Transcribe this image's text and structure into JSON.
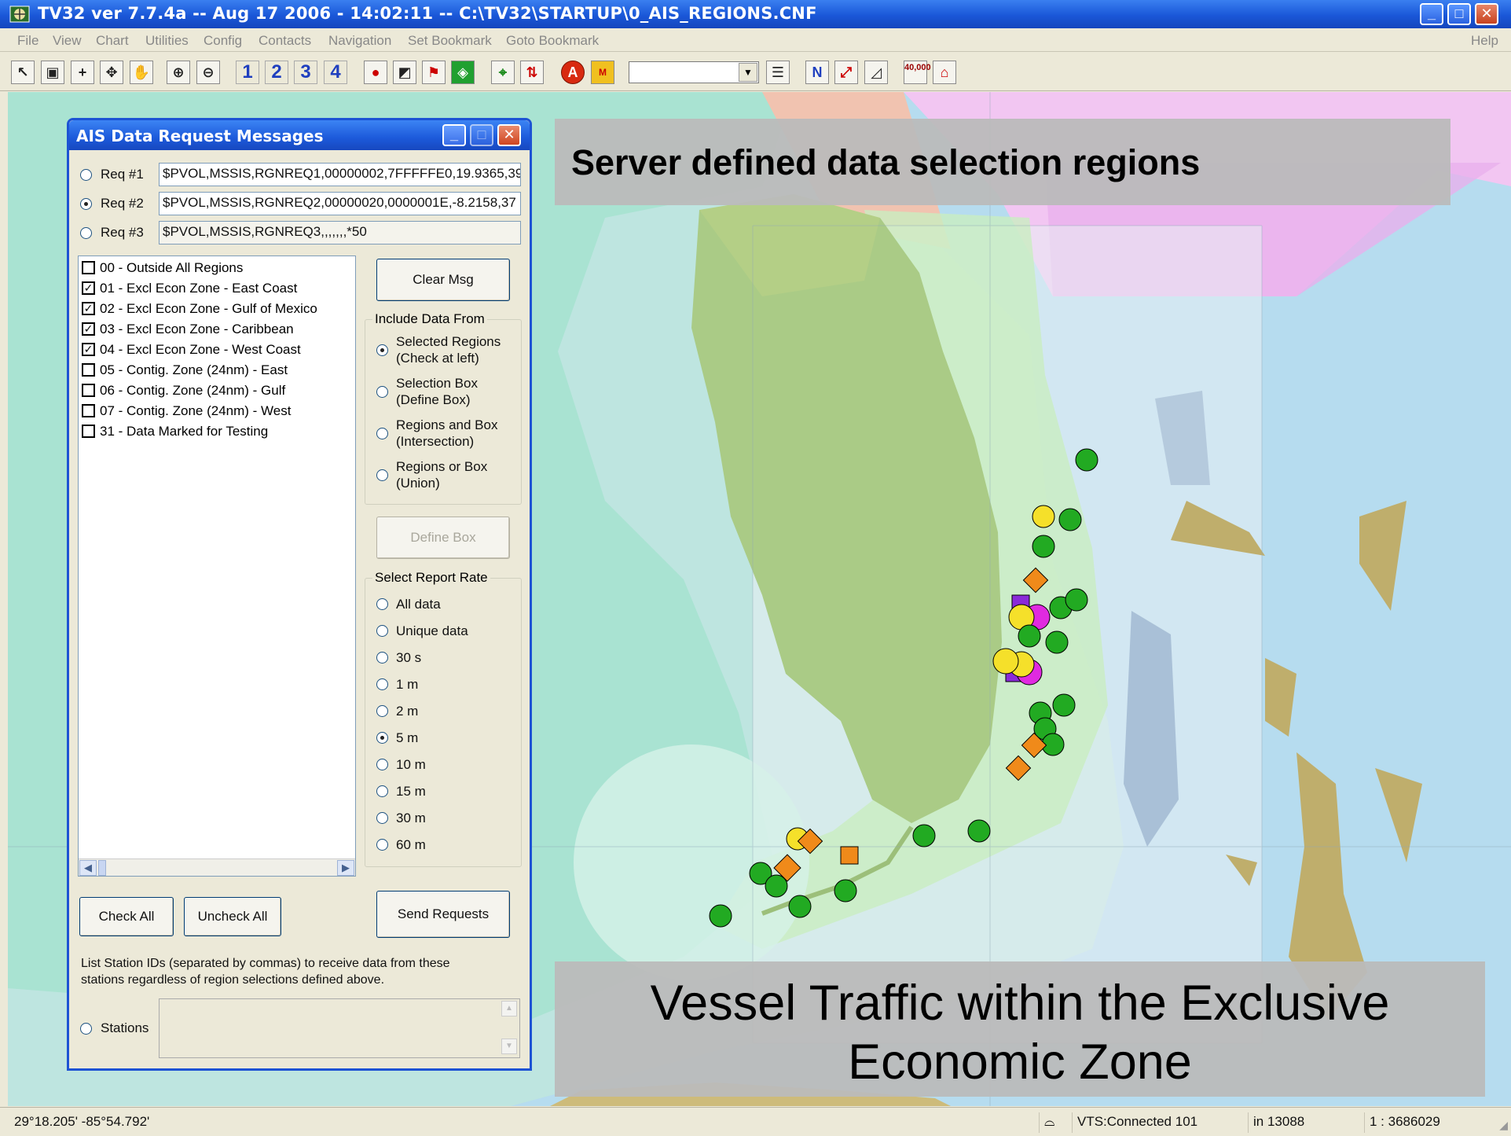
{
  "window": {
    "title": "TV32 ver 7.7.4a -- Aug 17 2006 - 14:02:11 -- C:\\TV32\\STARTUP\\0_AIS_REGIONS.CNF",
    "buttons": [
      "minimize",
      "maximize",
      "close"
    ]
  },
  "menu": {
    "items": [
      "File",
      "View",
      "Chart",
      "Utilities",
      "Config",
      "Contacts",
      "Navigation",
      "Set Bookmark",
      "Goto Bookmark"
    ],
    "help": "Help"
  },
  "toolbar": {
    "mode_buttons": [
      "1",
      "2",
      "3",
      "4"
    ],
    "icons": [
      "pointer-icon",
      "zoom-box-icon",
      "crosshair-icon",
      "pan-icon",
      "hand-icon",
      "zoom-in-icon",
      "zoom-out-icon",
      "marker-icon",
      "chart-icon",
      "flag-icon",
      "world-icon",
      "grid-icon",
      "target-icon",
      "alarm-icon",
      "mob-icon",
      "list-icon",
      "north-up-icon",
      "course-icon",
      "track-icon",
      "scale-icon",
      "home-icon"
    ],
    "scale_button": "40,000",
    "combo_value": ""
  },
  "callouts": {
    "top": "Server defined data selection regions",
    "bottom": "Vessel Traffic within the Exclusive Economic Zone"
  },
  "dialog": {
    "title": "AIS Data Request Messages",
    "requests": [
      {
        "label": "Req #1",
        "value": "$PVOL,MSSIS,RGNREQ1,00000002,7FFFFFE0,19.9365,39",
        "selected": false
      },
      {
        "label": "Req #2",
        "value": "$PVOL,MSSIS,RGNREQ2,00000020,0000001E,-8.2158,37",
        "selected": true
      },
      {
        "label": "Req #3",
        "value": "$PVOL,MSSIS,RGNREQ3,,,,,,,*50",
        "selected": false
      }
    ],
    "regions": [
      {
        "label": "00 - Outside All Regions",
        "checked": false
      },
      {
        "label": "01 - Excl Econ Zone - East Coast",
        "checked": true
      },
      {
        "label": "02 - Excl Econ Zone - Gulf of Mexico",
        "checked": true
      },
      {
        "label": "03 - Excl Econ Zone - Caribbean",
        "checked": true
      },
      {
        "label": "04 - Excl Econ Zone - West Coast",
        "checked": true
      },
      {
        "label": "05 - Contig. Zone (24nm) - East",
        "checked": false
      },
      {
        "label": "06 - Contig. Zone (24nm) - Gulf",
        "checked": false
      },
      {
        "label": "07 - Contig. Zone (24nm) - West",
        "checked": false
      },
      {
        "label": "31 - Data Marked for Testing",
        "checked": false
      }
    ],
    "clear_msg": "Clear Msg",
    "include_group": "Include Data From",
    "include_options": [
      {
        "l1": "Selected Regions",
        "l2": "(Check at left)",
        "selected": true
      },
      {
        "l1": "Selection Box",
        "l2": "(Define Box)",
        "selected": false
      },
      {
        "l1": "Regions and Box",
        "l2": "(Intersection)",
        "selected": false
      },
      {
        "l1": "Regions or Box",
        "l2": "(Union)",
        "selected": false
      }
    ],
    "define_box": "Define Box",
    "rate_group": "Select Report Rate",
    "rates": [
      {
        "label": "All data",
        "selected": false
      },
      {
        "label": "Unique data",
        "selected": false
      },
      {
        "label": "30 s",
        "selected": false
      },
      {
        "label": "1 m",
        "selected": false
      },
      {
        "label": "2 m",
        "selected": false
      },
      {
        "label": "5 m",
        "selected": true
      },
      {
        "label": "10 m",
        "selected": false
      },
      {
        "label": "15 m",
        "selected": false
      },
      {
        "label": "30 m",
        "selected": false
      },
      {
        "label": "60 m",
        "selected": false
      }
    ],
    "check_all": "Check All",
    "uncheck_all": "Uncheck All",
    "send_requests": "Send Requests",
    "stations_note": "List Station IDs (separated by commas) to receive data from these stations regardless of region selections defined above.",
    "stations_label": "Stations",
    "stations_value": ""
  },
  "status": {
    "coords": "29°18.205'  -85°54.792'",
    "connection": "VTS:Connected 101",
    "range": "in 13088",
    "scale": "1 : 3686029"
  }
}
